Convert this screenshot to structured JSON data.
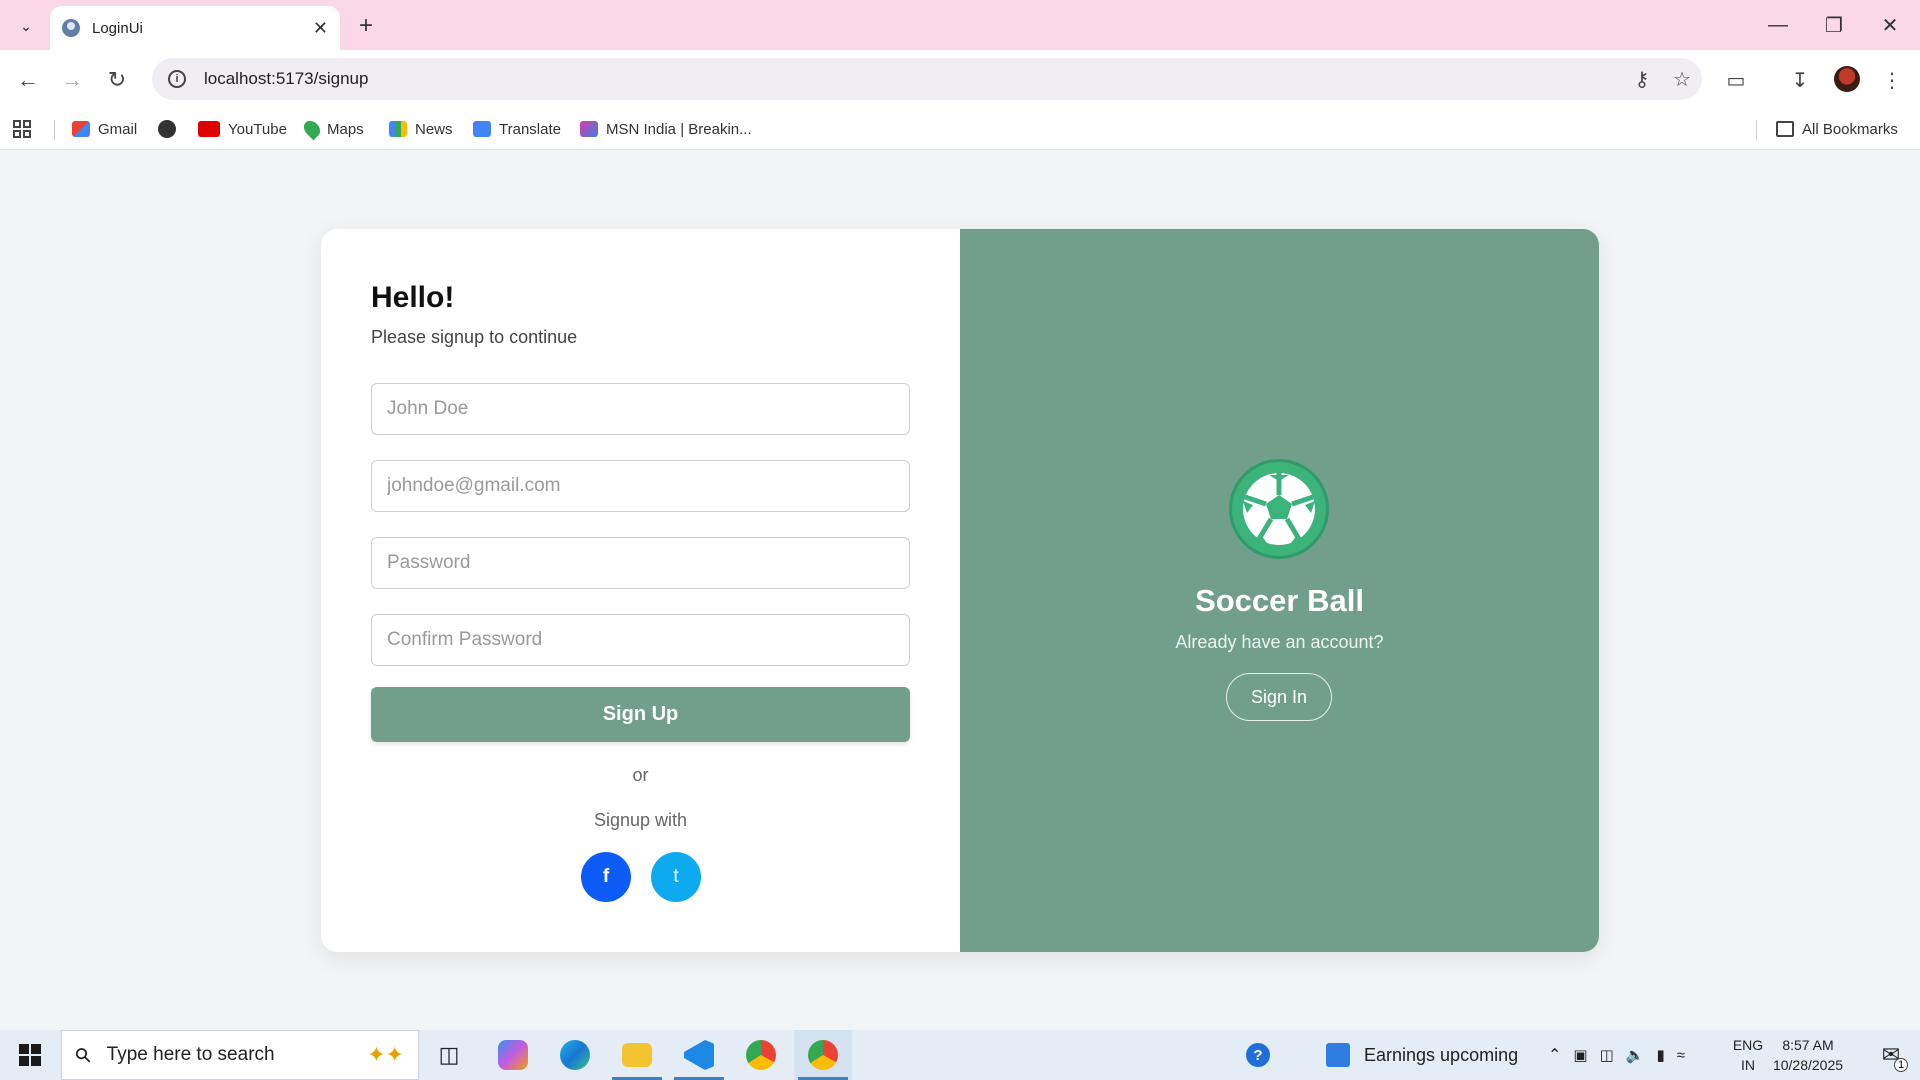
{
  "browser": {
    "tab_title": "LoginUi",
    "url": "localhost:5173/signup",
    "bookmarks": [
      {
        "label": "Gmail",
        "icon": "gmail-icon"
      },
      {
        "label": "",
        "icon": "globe-icon"
      },
      {
        "label": "YouTube",
        "icon": "youtube-icon"
      },
      {
        "label": "Maps",
        "icon": "maps-icon"
      },
      {
        "label": "News",
        "icon": "news-icon"
      },
      {
        "label": "Translate",
        "icon": "translate-icon"
      },
      {
        "label": "MSN India | Breakin...",
        "icon": "msn-icon"
      }
    ],
    "all_bookmarks": "All Bookmarks"
  },
  "signup": {
    "heading": "Hello!",
    "subheading": "Please signup to continue",
    "name_placeholder": "John Doe",
    "email_placeholder": "johndoe@gmail.com",
    "password_placeholder": "Password",
    "confirm_placeholder": "Confirm Password",
    "submit_label": "Sign Up",
    "or_text": "or",
    "signup_with": "Signup with",
    "facebook_label": "f",
    "twitter_label": "t"
  },
  "panel": {
    "brand": "Soccer Ball",
    "prompt": "Already have an account?",
    "signin_label": "Sign In"
  },
  "taskbar": {
    "search_placeholder": "Type here to search",
    "widget_text": "Earnings upcoming",
    "lang_top": "ENG",
    "lang_bottom": "IN",
    "time": "8:57 AM",
    "date": "10/28/2025",
    "notification_count": "1"
  },
  "colors": {
    "accent": "#719f8c",
    "facebook": "#0d5cf7",
    "twitter": "#0eaaf0",
    "tab_strip": "#fad8e7"
  }
}
